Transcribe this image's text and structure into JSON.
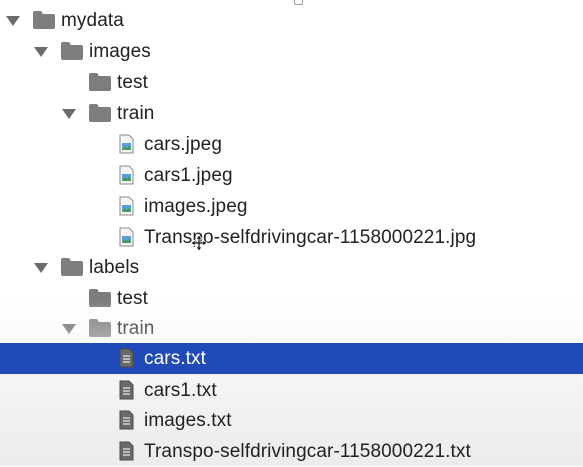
{
  "tree": {
    "root": {
      "label": "mydata",
      "expanded": true
    },
    "images_folder": {
      "label": "images",
      "expanded": true
    },
    "images_test": {
      "label": "test"
    },
    "images_train": {
      "label": "train",
      "expanded": true
    },
    "image_files": [
      "cars.jpeg",
      "cars1.jpeg",
      "images.jpeg",
      "Transpo-selfdrivingcar-1158000221.jpg"
    ],
    "labels_folder": {
      "label": "labels",
      "expanded": true
    },
    "labels_test": {
      "label": "test"
    },
    "labels_train": {
      "label": "train",
      "expanded": true
    },
    "label_files": [
      "cars.txt",
      "cars1.txt",
      "images.txt",
      "Transpo-selfdrivingcar-1158000221.txt"
    ],
    "selected": "cars.txt"
  },
  "colors": {
    "selection": "#1f4ab8",
    "folder": "#7d7d7d",
    "text": "#222222",
    "arrow": "#6b6b6b"
  },
  "icons": {
    "expand": "triangle-down-icon",
    "folder": "folder-icon",
    "image_file": "image-file-icon",
    "text_file": "text-file-icon"
  }
}
